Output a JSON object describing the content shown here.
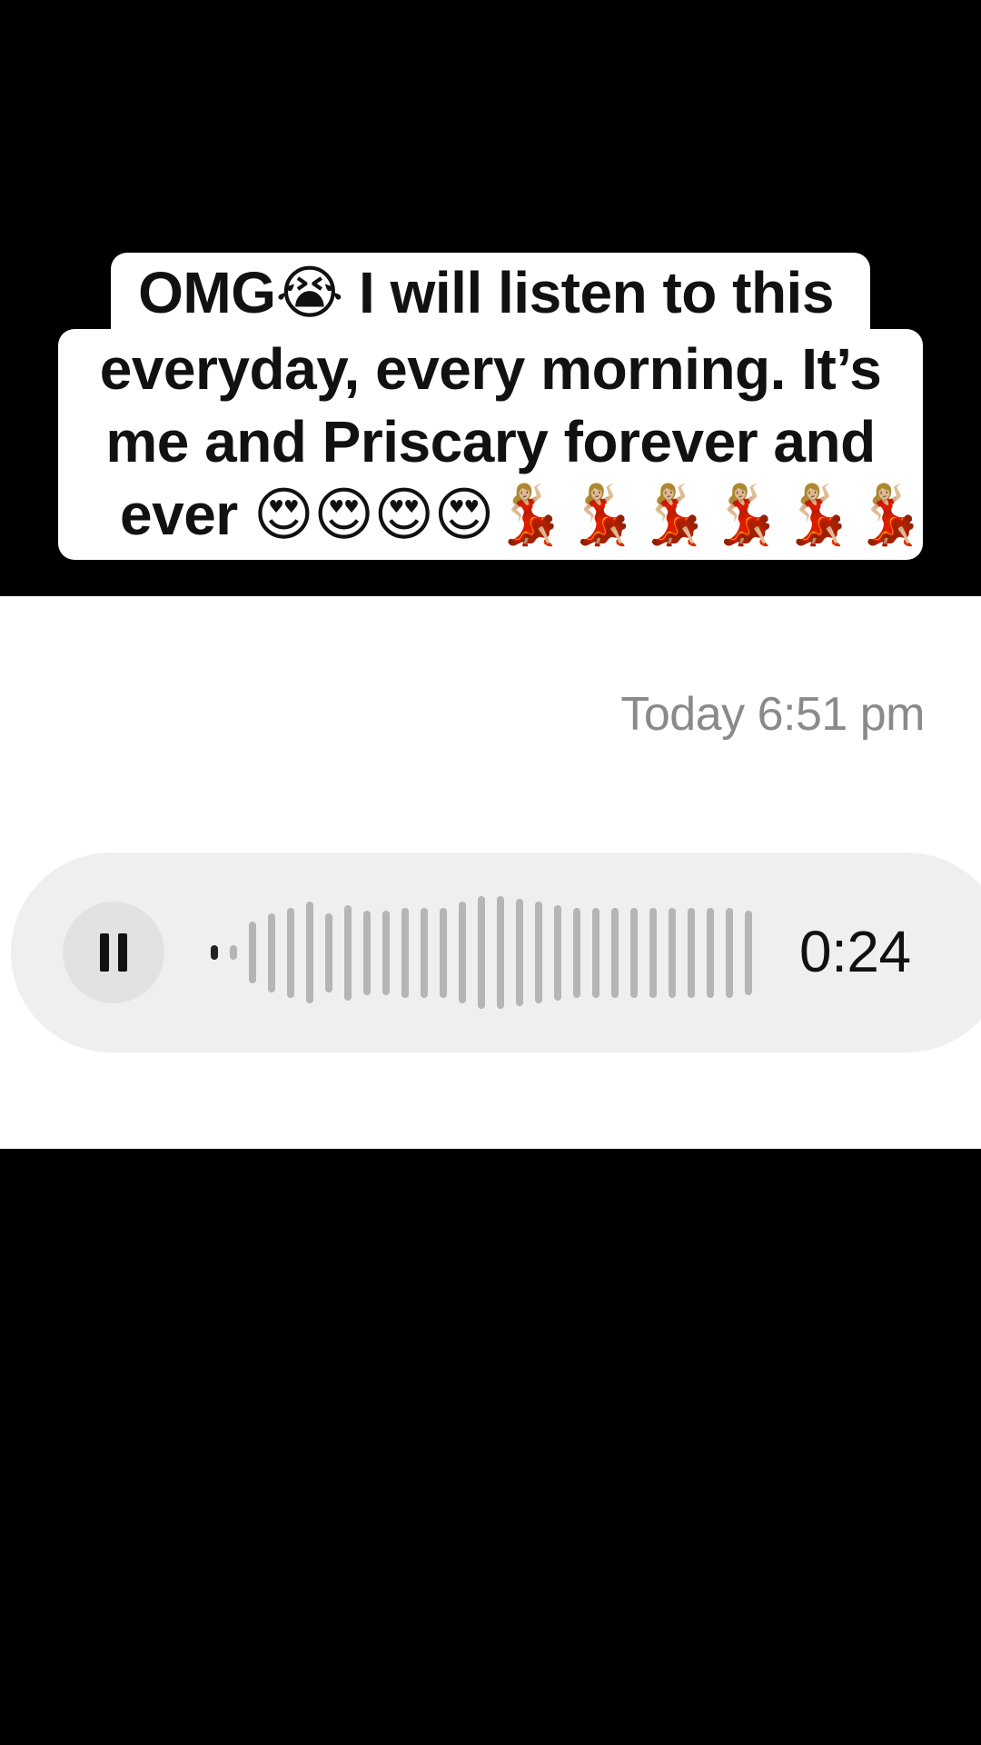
{
  "caption": {
    "lines": [
      "OMG😭 I will listen to this",
      "everyday, every morning. It’s",
      "me and Priscary forever and",
      "ever 😍😍😍😍💃🏼💃🏼💃🏼💃🏼💃🏼💃🏼"
    ]
  },
  "message": {
    "timestamp": "Today 6:51 pm",
    "voice_note": {
      "state": "playing",
      "control_icon": "pause-icon",
      "duration": "0:24",
      "progress_fraction": 0.04,
      "waveform_levels": [
        0.13,
        0.13,
        0.55,
        0.7,
        0.8,
        0.9,
        0.7,
        0.85,
        0.75,
        0.75,
        0.8,
        0.8,
        0.8,
        0.9,
        1.0,
        1.0,
        0.95,
        0.9,
        0.85,
        0.8,
        0.8,
        0.8,
        0.8,
        0.8,
        0.8,
        0.8,
        0.8,
        0.8,
        0.75
      ]
    }
  },
  "colors": {
    "background": "#000000",
    "panel": "#ffffff",
    "bubble": "#efefef",
    "waveform_unplayed": "#b5b5b5",
    "waveform_played": "#222222",
    "timestamp": "#8a8a8e"
  }
}
